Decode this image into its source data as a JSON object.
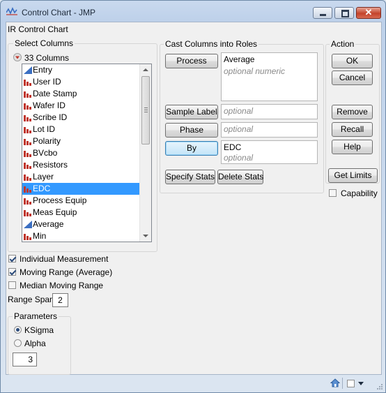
{
  "window": {
    "title": "Control Chart - JMP"
  },
  "dialog": {
    "heading": "IR Control Chart"
  },
  "select_columns": {
    "title": "Select Columns",
    "count_label": "33 Columns",
    "columns": [
      {
        "name": "Entry",
        "type": "continuous"
      },
      {
        "name": "User ID",
        "type": "nominal"
      },
      {
        "name": "Date Stamp",
        "type": "nominal"
      },
      {
        "name": "Wafer ID",
        "type": "nominal"
      },
      {
        "name": "Scribe ID",
        "type": "nominal"
      },
      {
        "name": "Lot ID",
        "type": "nominal"
      },
      {
        "name": "Polarity",
        "type": "nominal"
      },
      {
        "name": "BVcbo",
        "type": "nominal"
      },
      {
        "name": "Resistors",
        "type": "nominal"
      },
      {
        "name": "Layer",
        "type": "nominal"
      },
      {
        "name": "EDC",
        "type": "nominal",
        "selected": true
      },
      {
        "name": "Process Equip",
        "type": "nominal"
      },
      {
        "name": "Meas Equip",
        "type": "nominal"
      },
      {
        "name": "Average",
        "type": "continuous"
      },
      {
        "name": "Min",
        "type": "nominal"
      }
    ]
  },
  "cast_columns": {
    "title": "Cast Columns into Roles",
    "process": {
      "button": "Process",
      "value": "Average",
      "hint": "optional numeric"
    },
    "sample_label": {
      "button": "Sample Label",
      "placeholder": "optional"
    },
    "phase": {
      "button": "Phase",
      "placeholder": "optional"
    },
    "by": {
      "button": "By",
      "value": "EDC",
      "hint": "optional"
    },
    "specify_stats": "Specify Stats",
    "delete_stats": "Delete Stats"
  },
  "action": {
    "title": "Action",
    "ok": "OK",
    "cancel": "Cancel",
    "remove": "Remove",
    "recall": "Recall",
    "help": "Help"
  },
  "get_limits": "Get Limits",
  "capability": {
    "label": "Capability",
    "checked": false
  },
  "options": {
    "individual_measurement": {
      "label": "Individual Measurement",
      "checked": true
    },
    "moving_range_average": {
      "label": "Moving Range (Average)",
      "checked": true
    },
    "median_moving_range": {
      "label": "Median Moving Range",
      "checked": false
    },
    "range_span": {
      "label": "Range Span",
      "value": "2"
    }
  },
  "parameters": {
    "title": "Parameters",
    "ksigma": {
      "label": "KSigma",
      "selected": true
    },
    "alpha": {
      "label": "Alpha",
      "selected": false
    },
    "value": "3"
  },
  "colors": {
    "selection": "#3399ff",
    "nominal_icon": "#c0352b",
    "continuous_icon": "#3b6fc2"
  },
  "icons": [
    "jmp-logo-icon",
    "minimize-icon",
    "maximize-icon",
    "close-icon",
    "disclosure-triangle-icon",
    "nominal-column-icon",
    "continuous-column-icon",
    "home-icon",
    "checkbox-icon",
    "dropdown-arrow-icon",
    "resize-grip-icon"
  ]
}
